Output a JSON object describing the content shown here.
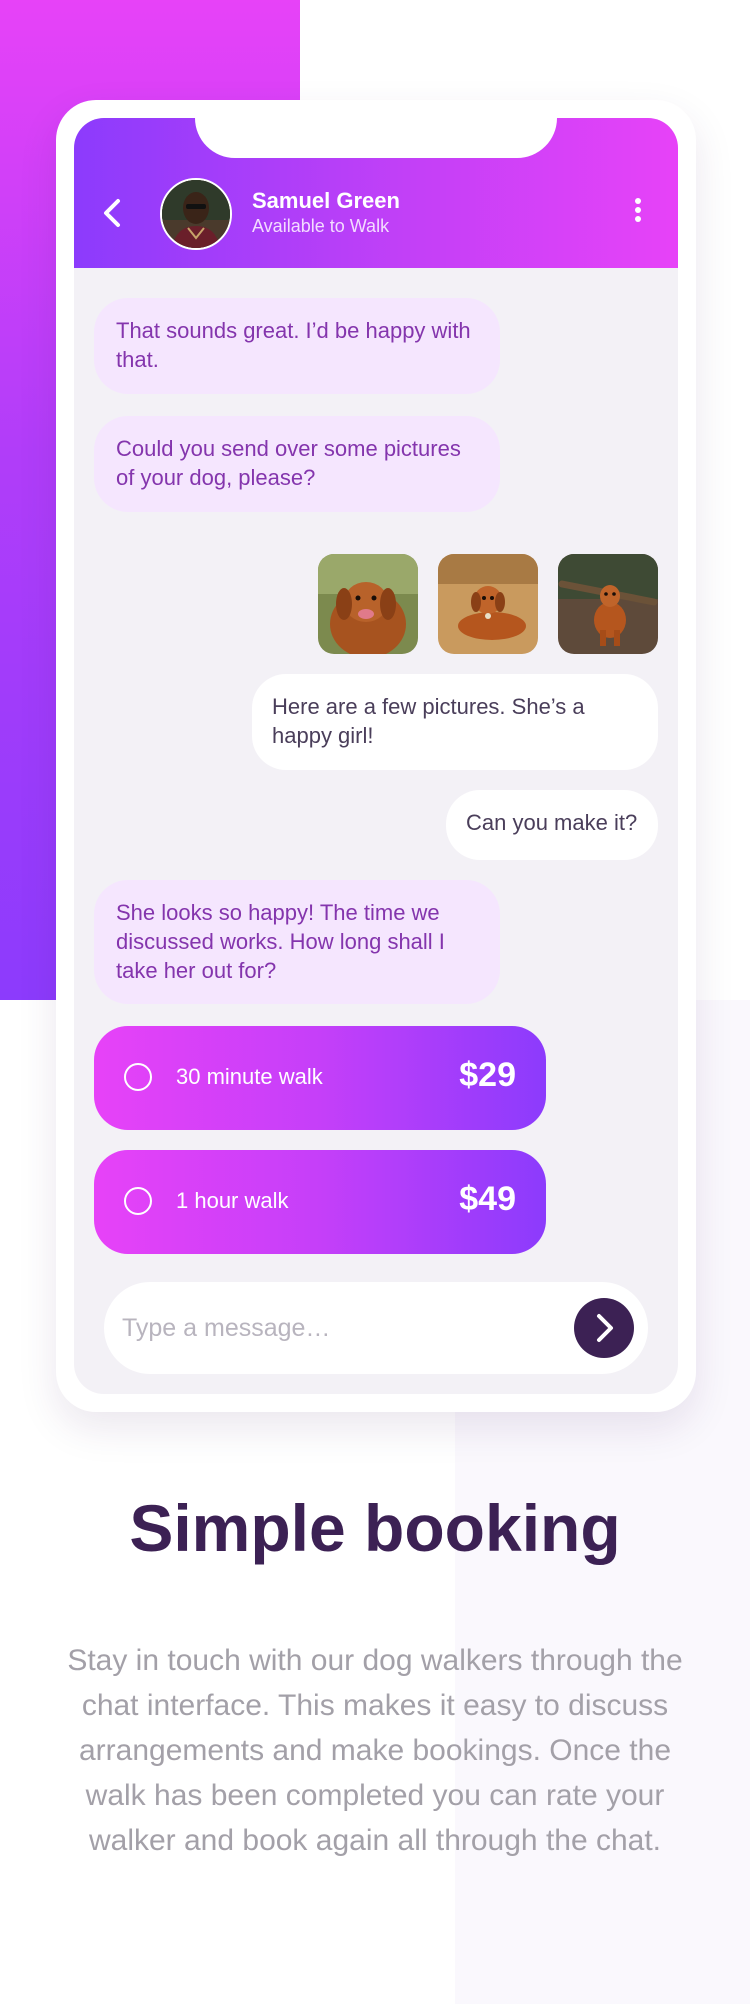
{
  "chat": {
    "walker_name": "Samuel Green",
    "walker_status": "Available to Walk",
    "messages": [
      {
        "from": "walker",
        "text": "That sounds great. I’d be happy with that."
      },
      {
        "from": "walker",
        "text": "Could you send over some pictures of your dog, please?"
      },
      {
        "from": "owner",
        "text": "Here are a few pictures. She’s a happy girl!"
      },
      {
        "from": "owner",
        "text": "Can you make it?"
      },
      {
        "from": "walker",
        "text": "She looks so happy! The time we discussed works. How long shall I take her out for?"
      }
    ],
    "walk_options": [
      {
        "label": "30 minute walk",
        "price": "$29"
      },
      {
        "label": "1 hour walk",
        "price": "$49"
      }
    ],
    "input_placeholder": "Type a message…"
  },
  "section": {
    "title": "Simple booking",
    "body": "Stay in touch with our dog walkers through the chat interface. This makes it easy to discuss arrangements and make bookings. Once the walk has been completed you can rate your walker and book again all through the chat."
  },
  "colors": {
    "gradient_pink": "#e742f8",
    "gradient_purple": "#8c3bfc",
    "dark_purple": "#3c2154",
    "incoming_bubble": "#f5e6fe",
    "incoming_text": "#8435ad"
  },
  "icons": {
    "back": "chevron-left-icon",
    "menu": "kebab-menu-icon",
    "send": "chevron-right-icon",
    "radio": "radio-circle-icon"
  }
}
